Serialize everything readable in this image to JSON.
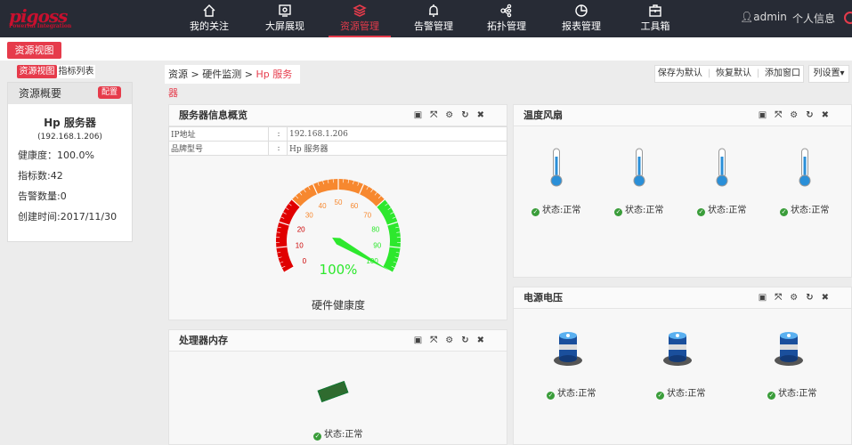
{
  "header": {
    "logo": "pigoss",
    "logo_sub": "Powerful Integration",
    "nav": [
      {
        "label": "我的关注",
        "icon": "home-icon"
      },
      {
        "label": "大屏展现",
        "icon": "screen-icon"
      },
      {
        "label": "资源管理",
        "icon": "layers-icon",
        "active": true
      },
      {
        "label": "告警管理",
        "icon": "bell-icon"
      },
      {
        "label": "拓扑管理",
        "icon": "topology-icon"
      },
      {
        "label": "报表管理",
        "icon": "pie-chart-icon"
      },
      {
        "label": "工具箱",
        "icon": "toolbox-icon"
      }
    ],
    "user": "admin",
    "profile": "个人信息"
  },
  "view_button": "资源视图",
  "tabs": [
    "资源视图",
    "指标列表"
  ],
  "sidebar": {
    "title": "资源概要",
    "config": "配置",
    "name": "Hp 服务器",
    "ip": "(192.168.1.206)",
    "health": "健康度：100.0%",
    "metrics": "指标数:42",
    "alerts": "告警数量:0",
    "created": "创建时间:2017/11/30"
  },
  "breadcrumb": {
    "a": "资源",
    "sep": ">",
    "b": "硬件监测",
    "c": "Hp 服务器"
  },
  "toolbar": {
    "save": "保存为默认",
    "restore": "恢复默认",
    "add": "添加窗口",
    "columns": "列设置▾"
  },
  "overview": {
    "title": "服务器信息概览",
    "rows": [
      {
        "k": "IP地址",
        "sep": ":",
        "v": "192.168.1.206"
      },
      {
        "k": "品牌型号",
        "sep": ":",
        "v": "Hp 服务器"
      }
    ],
    "gauge": {
      "value": 100,
      "min": 0,
      "max": 100,
      "display": "100%",
      "label": "硬件健康度",
      "ticks": [
        "0",
        "10",
        "20",
        "30",
        "40",
        "50",
        "60",
        "70",
        "80",
        "90",
        "100"
      ],
      "colors": {
        "low": "#e00000",
        "mid": "#f7882f",
        "high": "#2de82d"
      }
    }
  },
  "cpu": {
    "title": "处理器内存",
    "status": "状态:正常"
  },
  "temp": {
    "title": "温度风扇",
    "items": [
      "状态:正常",
      "状态:正常",
      "状态:正常",
      "状态:正常"
    ]
  },
  "power": {
    "title": "电源电压",
    "items": [
      "状态:正常",
      "状态:正常",
      "状态:正常"
    ]
  }
}
